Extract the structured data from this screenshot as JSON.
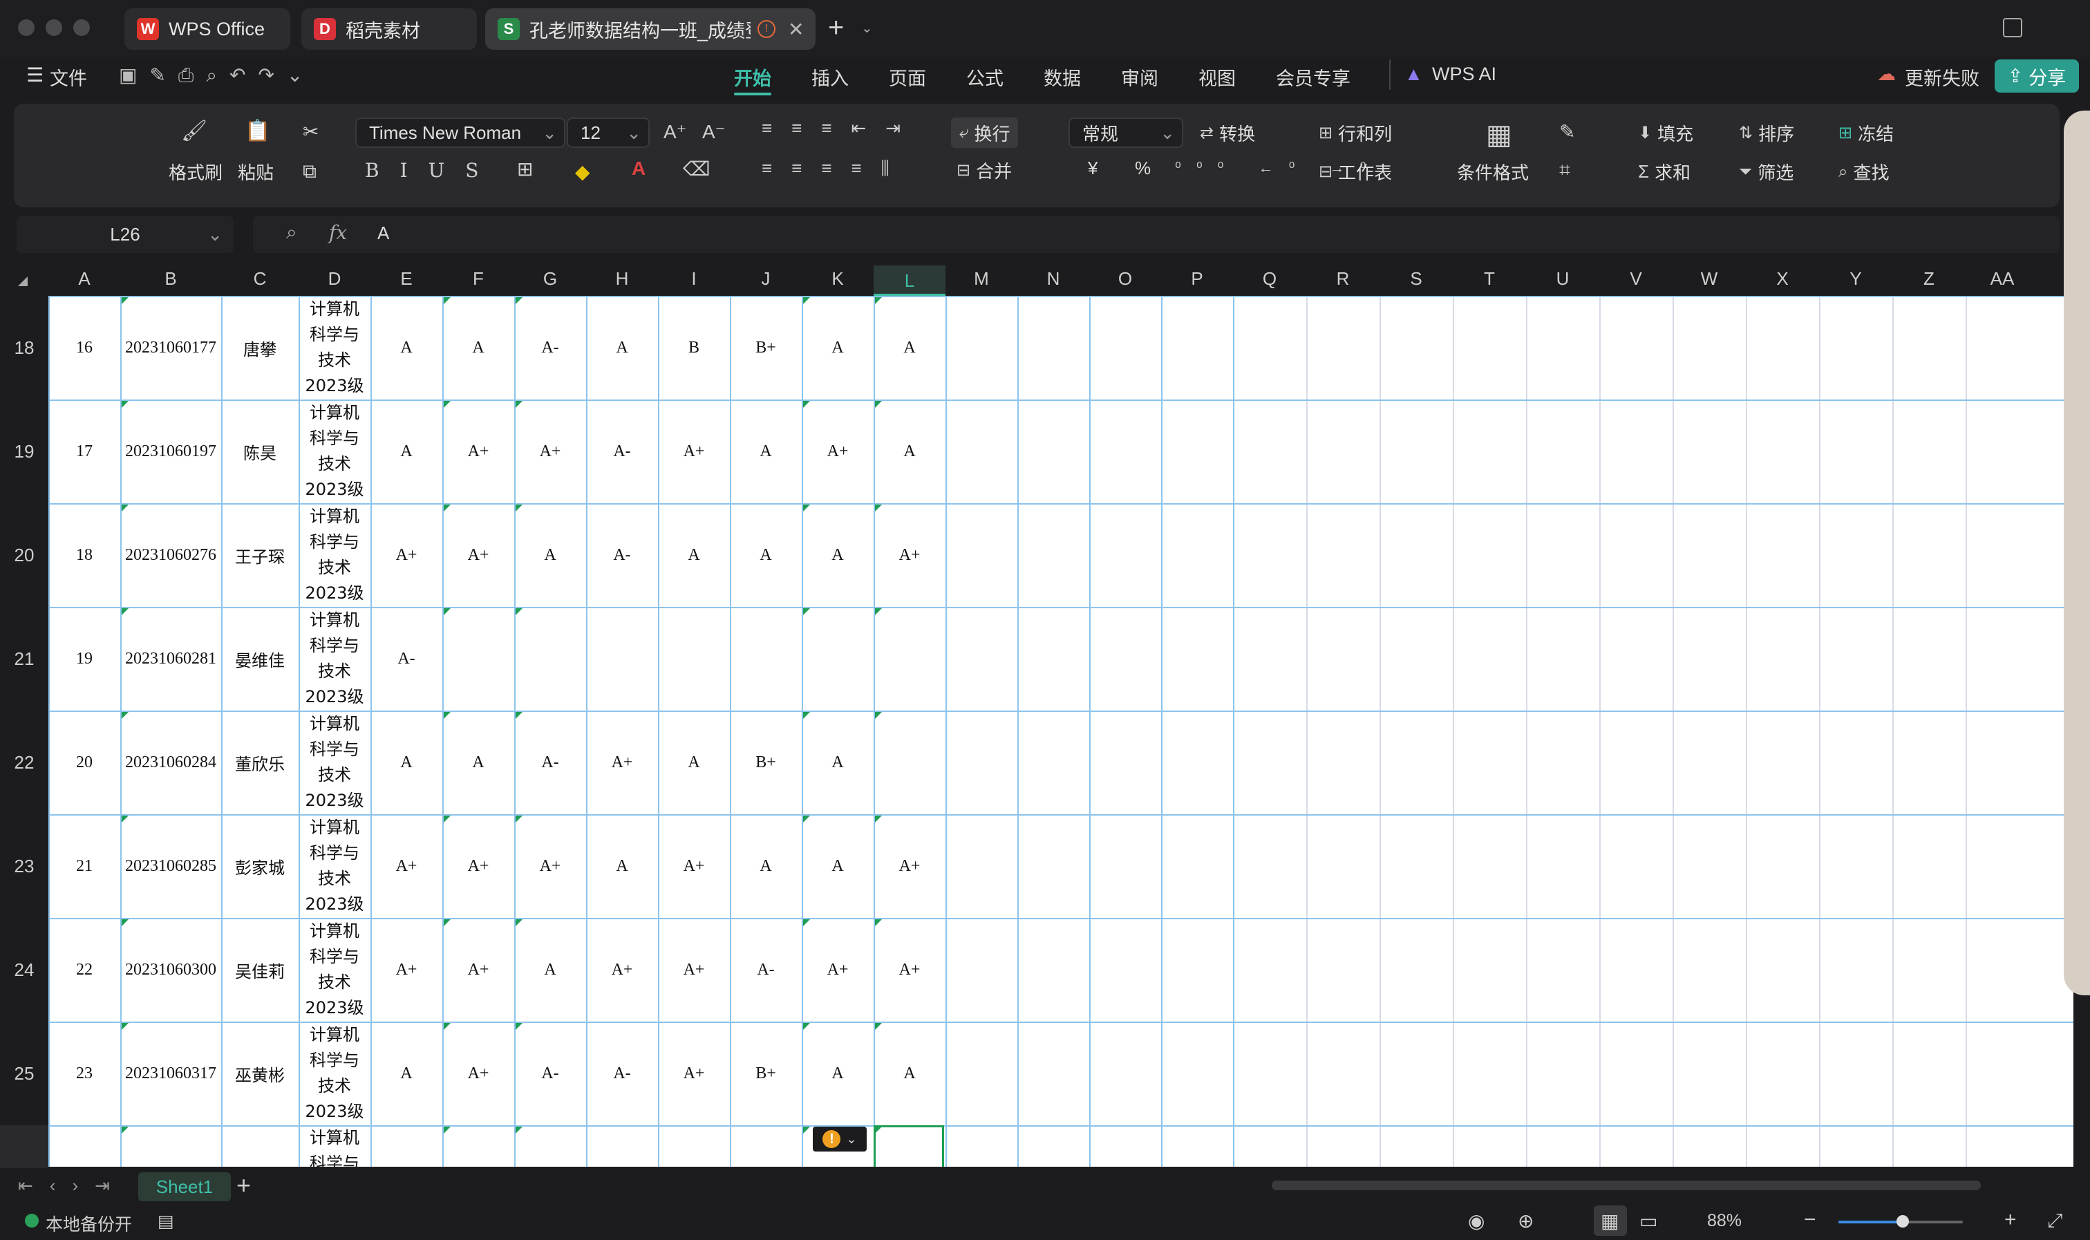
{
  "window": {
    "tabs": [
      {
        "label": "WPS Office",
        "logo": "W",
        "color": "#e0342a"
      },
      {
        "label": "稻壳素材",
        "logo": "D",
        "color": "#d9313a"
      },
      {
        "label": "孔老师数据结构一班_成绩登",
        "logo": "S",
        "color": "#2a8a4a"
      }
    ],
    "new_tab": "+",
    "warn_icon": "warning-icon"
  },
  "menu": {
    "file": "文件",
    "items": [
      "开始",
      "插入",
      "页面",
      "公式",
      "数据",
      "审阅",
      "视图",
      "会员专享"
    ],
    "active": "开始",
    "ai": "WPS AI",
    "update_fail": "更新失败",
    "share": "分享",
    "accent": "#2a9d8f"
  },
  "ribbon": {
    "format_painter": "格式刷",
    "paste": "粘贴",
    "font_name": "Times New Roman",
    "font_size": "12",
    "wrap": "换行",
    "merge": "合并",
    "number_format": "常规",
    "convert": "转换",
    "rows_cols": "行和列",
    "worksheet": "工作表",
    "cond_format": "条件格式",
    "fill": "填充",
    "sort": "排序",
    "freeze": "冻结",
    "sum": "求和",
    "filter": "筛选",
    "find": "查找",
    "currency": "¥",
    "percent": "%"
  },
  "formula_bar": {
    "name_box": "L26",
    "fx": "fx",
    "content": "A"
  },
  "columns": [
    "A",
    "B",
    "C",
    "D",
    "E",
    "F",
    "G",
    "H",
    "I",
    "J",
    "K",
    "L",
    "M",
    "N",
    "O",
    "P",
    "Q",
    "R",
    "S",
    "T",
    "U",
    "V",
    "W",
    "X",
    "Y",
    "Z",
    "AA"
  ],
  "active_column": "L",
  "rows": [
    {
      "row": "18",
      "no": "16",
      "id": "20231060177",
      "name": "唐攀",
      "dept": [
        "计算机",
        "科学与",
        "技术",
        "2023级"
      ],
      "grades": [
        "A",
        "A",
        "A-",
        "A",
        "B",
        "B+",
        "A",
        "A"
      ]
    },
    {
      "row": "19",
      "no": "17",
      "id": "20231060197",
      "name": "陈昊",
      "dept": [
        "计算机",
        "科学与",
        "技术",
        "2023级"
      ],
      "grades": [
        "A",
        "A+",
        "A+",
        "A-",
        "A+",
        "A",
        "A+",
        "A"
      ]
    },
    {
      "row": "20",
      "no": "18",
      "id": "20231060276",
      "name": "王子琛",
      "dept": [
        "计算机",
        "科学与",
        "技术",
        "2023级"
      ],
      "grades": [
        "A+",
        "A+",
        "A",
        "A-",
        "A",
        "A",
        "A",
        "A+"
      ]
    },
    {
      "row": "21",
      "no": "19",
      "id": "20231060281",
      "name": "晏维佳",
      "dept": [
        "计算机",
        "科学与",
        "技术",
        "2023级"
      ],
      "grades": [
        "A-",
        "",
        "",
        "",
        "",
        "",
        "",
        ""
      ]
    },
    {
      "row": "22",
      "no": "20",
      "id": "20231060284",
      "name": "董欣乐",
      "dept": [
        "计算机",
        "科学与",
        "技术",
        "2023级"
      ],
      "grades": [
        "A",
        "A",
        "A-",
        "A+",
        "A",
        "B+",
        "A",
        ""
      ]
    },
    {
      "row": "23",
      "no": "21",
      "id": "20231060285",
      "name": "彭家城",
      "dept": [
        "计算机",
        "科学与",
        "技术",
        "2023级"
      ],
      "grades": [
        "A+",
        "A+",
        "A+",
        "A",
        "A+",
        "A",
        "A",
        "A+"
      ]
    },
    {
      "row": "24",
      "no": "22",
      "id": "20231060300",
      "name": "吴佳莉",
      "dept": [
        "计算机",
        "科学与",
        "技术",
        "2023级"
      ],
      "grades": [
        "A+",
        "A+",
        "A",
        "A+",
        "A+",
        "A-",
        "A+",
        "A+"
      ]
    },
    {
      "row": "25",
      "no": "23",
      "id": "20231060317",
      "name": "巫黄彬",
      "dept": [
        "计算机",
        "科学与",
        "技术",
        "2023级"
      ],
      "grades": [
        "A",
        "A+",
        "A-",
        "A-",
        "A+",
        "B+",
        "A",
        "A"
      ]
    },
    {
      "row": "",
      "no": "",
      "id": "",
      "name": "",
      "dept": [
        "计算机",
        "科学与"
      ],
      "grades": [
        "",
        "",
        "",
        "",
        "",
        "",
        "",
        ""
      ]
    }
  ],
  "sheet_tabs": {
    "active": "Sheet1",
    "add": "+"
  },
  "status": {
    "backup": "本地备份开",
    "zoom": "88%"
  }
}
